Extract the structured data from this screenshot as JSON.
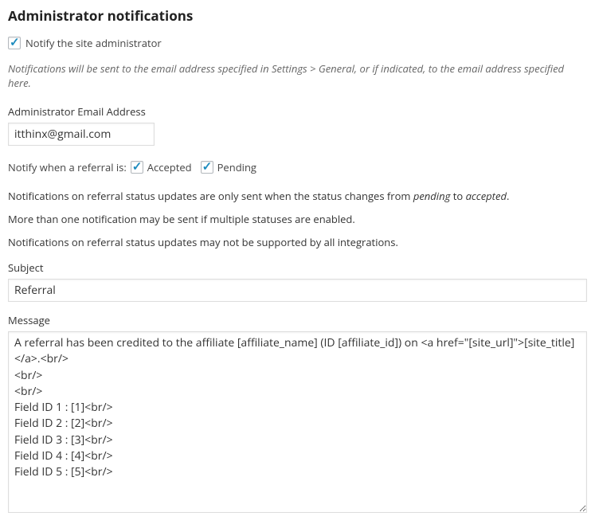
{
  "heading": "Administrator notifications",
  "notify_admin": {
    "label": "Notify the site administrator",
    "checked": true
  },
  "help": "Notifications will be sent to the email address specified in Settings > General, or if indicated, to the email address specified here.",
  "admin_email": {
    "label": "Administrator Email Address",
    "value": "itthinx@gmail.com"
  },
  "referral_status": {
    "prefix": "Notify when a referral is:",
    "accepted": {
      "label": "Accepted",
      "checked": true
    },
    "pending": {
      "label": "Pending",
      "checked": true
    }
  },
  "notes": {
    "line1_a": "Notifications on referral status updates are only sent when the status changes from ",
    "line1_b": "pending",
    "line1_c": " to ",
    "line1_d": "accepted",
    "line1_e": ".",
    "line2": "More than one notification may be sent if multiple statuses are enabled.",
    "line3": "Notifications on referral status updates may not be supported by all integrations."
  },
  "subject": {
    "label": "Subject",
    "value": "Referral"
  },
  "message": {
    "label": "Message",
    "value": "A referral has been credited to the affiliate [affiliate_name] (ID [affiliate_id]) on <a href=\"[site_url]\">[site_title]</a>.<br/>\n<br/>\n<br/>\nField ID 1 : [1]<br/>\nField ID 2 : [2]<br/>\nField ID 3 : [3]<br/>\nField ID 4 : [4]<br/>\nField ID 5 : [5]<br/>"
  }
}
